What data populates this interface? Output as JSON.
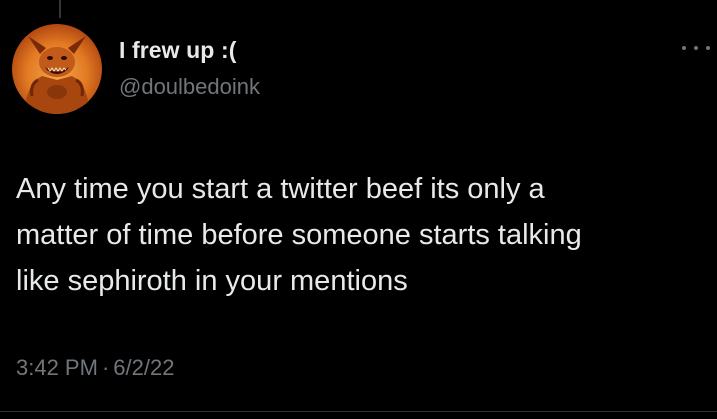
{
  "tweet": {
    "author": {
      "display_name": "I frew up :(",
      "handle": "@doulbedoink",
      "avatar_icon": "demon-avatar"
    },
    "text": "Any time you start a twitter beef its only a\nmatter of time before someone starts talking\nlike sephiroth in your mentions",
    "time": "3:42 PM",
    "separator": "·",
    "date": "6/2/22",
    "more_icon": "more-icon"
  },
  "colors": {
    "background": "#000000",
    "text_primary": "#e7e9ea",
    "text_secondary": "#71767b",
    "divider": "#2f3336"
  }
}
